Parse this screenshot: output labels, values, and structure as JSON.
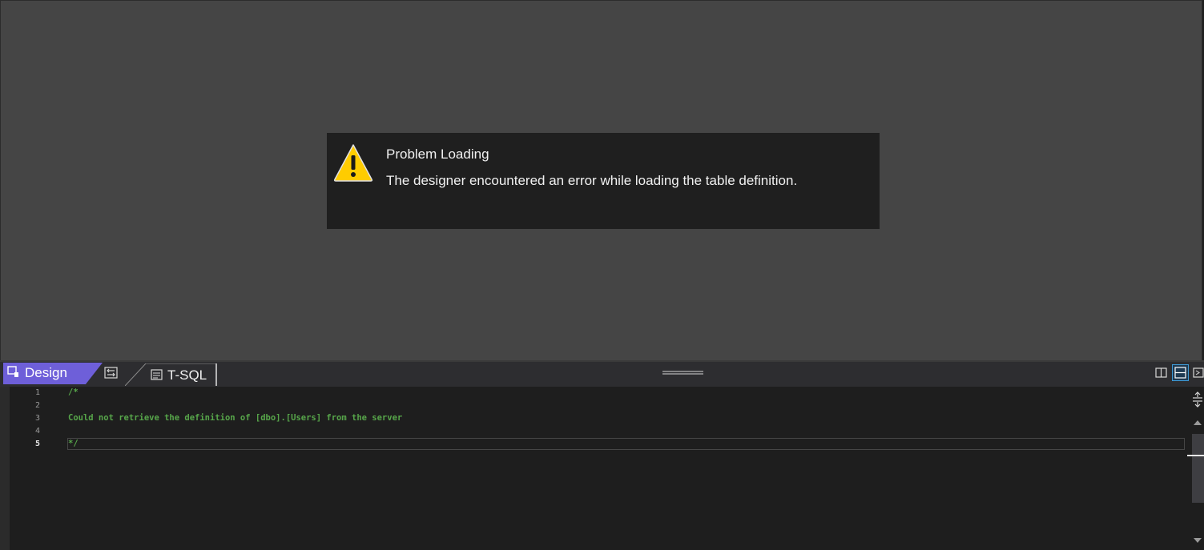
{
  "error": {
    "title": "Problem Loading",
    "message": "The designer encountered an error while loading the table definition."
  },
  "tabs": {
    "design_label": "Design",
    "tsql_label": "T-SQL",
    "active": "Design"
  },
  "editor": {
    "lines": [
      {
        "number": "1",
        "text": "/*"
      },
      {
        "number": "2",
        "text": ""
      },
      {
        "number": "3",
        "text": "Could not retrieve the definition of [dbo].[Users] from the server"
      },
      {
        "number": "4",
        "text": ""
      },
      {
        "number": "5",
        "text": "*/"
      }
    ],
    "current_line": "5"
  },
  "colors": {
    "design_tab_active": "#6e5fd9",
    "comment": "#57a64a",
    "warning": "#ffcc00",
    "layout_active": "#3e9bd8"
  },
  "icons": {
    "warning": "warning-icon",
    "design": "design-icon",
    "swap": "swap-panes-icon",
    "tsql": "sql-script-icon",
    "vertical_split": "vertical-split-icon",
    "horizontal_split": "horizontal-split-icon",
    "collapse": "collapse-pane-icon",
    "scroll_up": "scroll-up-arrow-icon",
    "scroll_down": "scroll-down-arrow-icon",
    "split_editor": "split-editor-icon"
  }
}
